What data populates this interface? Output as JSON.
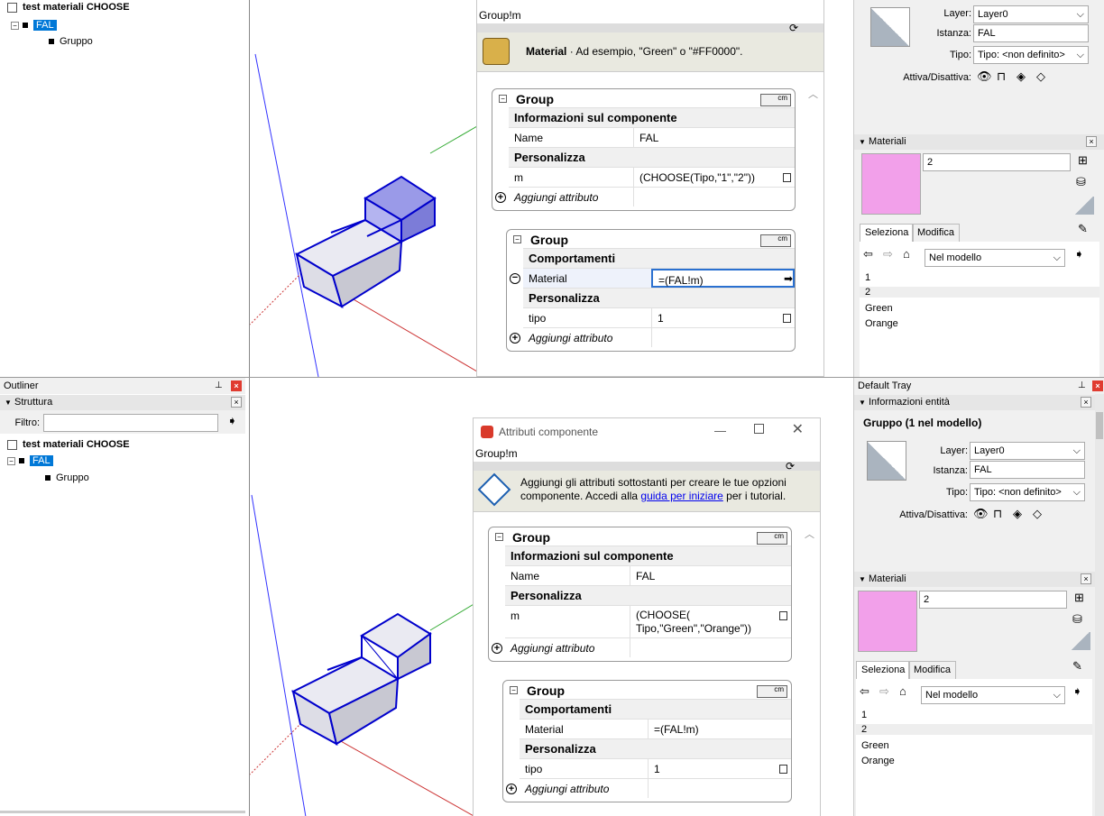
{
  "top": {
    "outliner": {
      "tree": {
        "root": "test materiali CHOOSE",
        "selected": "FAL",
        "child": "Gruppo"
      }
    },
    "dialog": {
      "path": "Group!m",
      "info_title": "Material",
      "info_text": " · Ad esempio, \"Green\" o \"#FF0000\".",
      "outer": {
        "title": "Group",
        "units": "cm",
        "section1": "Informazioni sul componente",
        "name_label": "Name",
        "name_value": "FAL",
        "section2": "Personalizza",
        "m_label": "m",
        "m_value": "(CHOOSE(Tipo,\"1\",\"2\"))",
        "add": "Aggiungi attributo"
      },
      "inner": {
        "title": "Group",
        "units": "cm",
        "section1": "Comportamenti",
        "material_label": "Material",
        "material_value": "=(FAL!m)",
        "section2": "Personalizza",
        "tipo_label": "tipo",
        "tipo_value": "1",
        "add": "Aggiungi attributo"
      }
    },
    "tray": {
      "layer_label": "Layer:",
      "layer_value": "Layer0",
      "instance_label": "Istanza:",
      "instance_value": "FAL",
      "type_label": "Tipo:",
      "type_value": "Tipo: <non definito>",
      "toggle_label": "Attiva/Disattiva:",
      "materials_header": "Materiali",
      "material_name": "2",
      "tab_select": "Seleziona",
      "tab_edit": "Modifica",
      "scope": "Nel modello",
      "list": [
        "1",
        "2",
        "Green",
        "Orange"
      ]
    }
  },
  "bottom": {
    "outliner": {
      "title": "Outliner",
      "section": "Struttura",
      "filter_label": "Filtro:",
      "filter_value": "",
      "tree": {
        "root": "test materiali CHOOSE",
        "selected": "FAL",
        "child": "Gruppo"
      }
    },
    "dialog": {
      "window_title": "Attributi componente",
      "path": "Group!m",
      "info_text": "Aggiungi gli attributi sottostanti per creare le tue opzioni componente. Accedi alla ",
      "info_link": "guida per iniziare",
      "info_tail": " per i tutorial.",
      "outer": {
        "title": "Group",
        "units": "cm",
        "section1": "Informazioni sul componente",
        "name_label": "Name",
        "name_value": "FAL",
        "section2": "Personalizza",
        "m_label": "m",
        "m_value_line1": "(CHOOSE(",
        "m_value_line2": "Tipo,\"Green\",\"Orange\"))",
        "add": "Aggiungi attributo"
      },
      "inner": {
        "title": "Group",
        "units": "cm",
        "section1": "Comportamenti",
        "material_label": "Material",
        "material_value": "=(FAL!m)",
        "section2": "Personalizza",
        "tipo_label": "tipo",
        "tipo_value": "1",
        "add": "Aggiungi attributo"
      }
    },
    "tray": {
      "title": "Default Tray",
      "entity_header": "Informazioni entità",
      "entity_summary": "Gruppo (1 nel modello)",
      "layer_label": "Layer:",
      "layer_value": "Layer0",
      "instance_label": "Istanza:",
      "instance_value": "FAL",
      "type_label": "Tipo:",
      "type_value": "Tipo: <non definito>",
      "toggle_label": "Attiva/Disattiva:",
      "materials_header": "Materiali",
      "material_name": "2",
      "tab_select": "Seleziona",
      "tab_edit": "Modifica",
      "scope": "Nel modello",
      "list": [
        "1",
        "2",
        "Green",
        "Orange"
      ]
    }
  },
  "colors": {
    "selection": "#0078d7",
    "material_swatch": "#f2a0ea",
    "edge_selected": "#0000cc",
    "close_red": "#e03c31"
  }
}
